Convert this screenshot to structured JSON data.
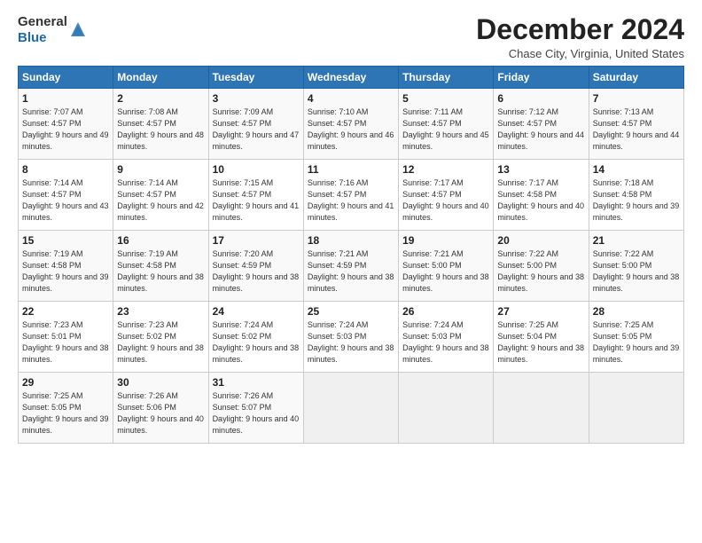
{
  "header": {
    "logo_line1": "General",
    "logo_line2": "Blue",
    "month": "December 2024",
    "location": "Chase City, Virginia, United States"
  },
  "weekdays": [
    "Sunday",
    "Monday",
    "Tuesday",
    "Wednesday",
    "Thursday",
    "Friday",
    "Saturday"
  ],
  "weeks": [
    [
      {
        "day": "1",
        "sunrise": "7:07 AM",
        "sunset": "4:57 PM",
        "daylight": "9 hours and 49 minutes."
      },
      {
        "day": "2",
        "sunrise": "7:08 AM",
        "sunset": "4:57 PM",
        "daylight": "9 hours and 48 minutes."
      },
      {
        "day": "3",
        "sunrise": "7:09 AM",
        "sunset": "4:57 PM",
        "daylight": "9 hours and 47 minutes."
      },
      {
        "day": "4",
        "sunrise": "7:10 AM",
        "sunset": "4:57 PM",
        "daylight": "9 hours and 46 minutes."
      },
      {
        "day": "5",
        "sunrise": "7:11 AM",
        "sunset": "4:57 PM",
        "daylight": "9 hours and 45 minutes."
      },
      {
        "day": "6",
        "sunrise": "7:12 AM",
        "sunset": "4:57 PM",
        "daylight": "9 hours and 44 minutes."
      },
      {
        "day": "7",
        "sunrise": "7:13 AM",
        "sunset": "4:57 PM",
        "daylight": "9 hours and 44 minutes."
      }
    ],
    [
      {
        "day": "8",
        "sunrise": "7:14 AM",
        "sunset": "4:57 PM",
        "daylight": "9 hours and 43 minutes."
      },
      {
        "day": "9",
        "sunrise": "7:14 AM",
        "sunset": "4:57 PM",
        "daylight": "9 hours and 42 minutes."
      },
      {
        "day": "10",
        "sunrise": "7:15 AM",
        "sunset": "4:57 PM",
        "daylight": "9 hours and 41 minutes."
      },
      {
        "day": "11",
        "sunrise": "7:16 AM",
        "sunset": "4:57 PM",
        "daylight": "9 hours and 41 minutes."
      },
      {
        "day": "12",
        "sunrise": "7:17 AM",
        "sunset": "4:57 PM",
        "daylight": "9 hours and 40 minutes."
      },
      {
        "day": "13",
        "sunrise": "7:17 AM",
        "sunset": "4:58 PM",
        "daylight": "9 hours and 40 minutes."
      },
      {
        "day": "14",
        "sunrise": "7:18 AM",
        "sunset": "4:58 PM",
        "daylight": "9 hours and 39 minutes."
      }
    ],
    [
      {
        "day": "15",
        "sunrise": "7:19 AM",
        "sunset": "4:58 PM",
        "daylight": "9 hours and 39 minutes."
      },
      {
        "day": "16",
        "sunrise": "7:19 AM",
        "sunset": "4:58 PM",
        "daylight": "9 hours and 38 minutes."
      },
      {
        "day": "17",
        "sunrise": "7:20 AM",
        "sunset": "4:59 PM",
        "daylight": "9 hours and 38 minutes."
      },
      {
        "day": "18",
        "sunrise": "7:21 AM",
        "sunset": "4:59 PM",
        "daylight": "9 hours and 38 minutes."
      },
      {
        "day": "19",
        "sunrise": "7:21 AM",
        "sunset": "5:00 PM",
        "daylight": "9 hours and 38 minutes."
      },
      {
        "day": "20",
        "sunrise": "7:22 AM",
        "sunset": "5:00 PM",
        "daylight": "9 hours and 38 minutes."
      },
      {
        "day": "21",
        "sunrise": "7:22 AM",
        "sunset": "5:00 PM",
        "daylight": "9 hours and 38 minutes."
      }
    ],
    [
      {
        "day": "22",
        "sunrise": "7:23 AM",
        "sunset": "5:01 PM",
        "daylight": "9 hours and 38 minutes."
      },
      {
        "day": "23",
        "sunrise": "7:23 AM",
        "sunset": "5:02 PM",
        "daylight": "9 hours and 38 minutes."
      },
      {
        "day": "24",
        "sunrise": "7:24 AM",
        "sunset": "5:02 PM",
        "daylight": "9 hours and 38 minutes."
      },
      {
        "day": "25",
        "sunrise": "7:24 AM",
        "sunset": "5:03 PM",
        "daylight": "9 hours and 38 minutes."
      },
      {
        "day": "26",
        "sunrise": "7:24 AM",
        "sunset": "5:03 PM",
        "daylight": "9 hours and 38 minutes."
      },
      {
        "day": "27",
        "sunrise": "7:25 AM",
        "sunset": "5:04 PM",
        "daylight": "9 hours and 38 minutes."
      },
      {
        "day": "28",
        "sunrise": "7:25 AM",
        "sunset": "5:05 PM",
        "daylight": "9 hours and 39 minutes."
      }
    ],
    [
      {
        "day": "29",
        "sunrise": "7:25 AM",
        "sunset": "5:05 PM",
        "daylight": "9 hours and 39 minutes."
      },
      {
        "day": "30",
        "sunrise": "7:26 AM",
        "sunset": "5:06 PM",
        "daylight": "9 hours and 40 minutes."
      },
      {
        "day": "31",
        "sunrise": "7:26 AM",
        "sunset": "5:07 PM",
        "daylight": "9 hours and 40 minutes."
      },
      null,
      null,
      null,
      null
    ]
  ]
}
